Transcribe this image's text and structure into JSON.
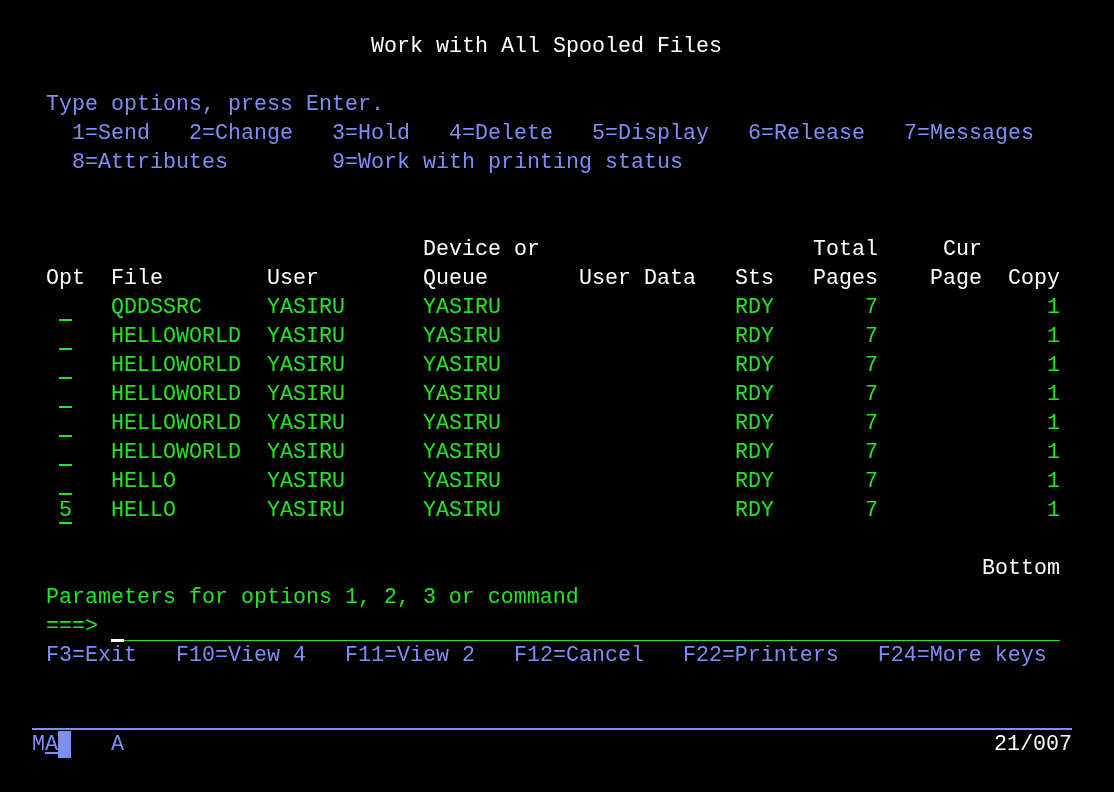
{
  "title": "Work with All Spooled Files",
  "instructions": "Type options, press Enter.",
  "options": [
    [
      "1=Send",
      "2=Change",
      "3=Hold",
      "4=Delete",
      "5=Display",
      "6=Release",
      "7=Messages"
    ],
    [
      "8=Attributes",
      "9=Work with printing status"
    ]
  ],
  "table": {
    "columns": [
      {
        "heading": [
          "Opt"
        ]
      },
      {
        "heading": [
          "File"
        ]
      },
      {
        "heading": [
          "User"
        ]
      },
      {
        "heading": [
          "Device or",
          "Queue"
        ]
      },
      {
        "heading": [
          "User Data"
        ]
      },
      {
        "heading": [
          "Sts"
        ]
      },
      {
        "heading": [
          "Total",
          "Pages"
        ]
      },
      {
        "heading": [
          "Cur",
          "Page"
        ]
      },
      {
        "heading": [
          "Copy"
        ]
      }
    ],
    "rows": [
      {
        "file": "QDDSSRC",
        "user": "YASIRU",
        "device_or_queue": "YASIRU",
        "status": "RDY",
        "total_pages": "7",
        "copy": "1"
      },
      {
        "file": "HELLOWORLD",
        "user": "YASIRU",
        "device_or_queue": "YASIRU",
        "status": "RDY",
        "total_pages": "7",
        "copy": "1"
      },
      {
        "file": "HELLOWORLD",
        "user": "YASIRU",
        "device_or_queue": "YASIRU",
        "status": "RDY",
        "total_pages": "7",
        "copy": "1"
      },
      {
        "file": "HELLOWORLD",
        "user": "YASIRU",
        "device_or_queue": "YASIRU",
        "status": "RDY",
        "total_pages": "7",
        "copy": "1"
      },
      {
        "file": "HELLOWORLD",
        "user": "YASIRU",
        "device_or_queue": "YASIRU",
        "status": "RDY",
        "total_pages": "7",
        "copy": "1"
      },
      {
        "file": "HELLOWORLD",
        "user": "YASIRU",
        "device_or_queue": "YASIRU",
        "status": "RDY",
        "total_pages": "7",
        "copy": "1"
      },
      {
        "file": "HELLO",
        "user": "YASIRU",
        "device_or_queue": "YASIRU",
        "status": "RDY",
        "total_pages": "7",
        "copy": "1"
      },
      {
        "option": "5",
        "file": "HELLO",
        "user": "YASIRU",
        "device_or_queue": "YASIRU",
        "status": "RDY",
        "total_pages": "7",
        "copy": "1"
      }
    ]
  },
  "list_position": "Bottom",
  "command": {
    "label": "Parameters for options 1, 2, 3 or command",
    "prompt": "===>",
    "focused": true
  },
  "function_keys": [
    "F3=Exit",
    "F10=View 4",
    "F11=View 2",
    "F12=Cancel",
    "F22=Printers",
    "F24=More keys"
  ],
  "status_bar": {
    "indicator": [
      {
        "text": "M",
        "underlined": false
      },
      {
        "text": "A",
        "underlined": true
      }
    ],
    "cursor_shown": true,
    "mode": "A",
    "cursor_position": "21/007"
  }
}
